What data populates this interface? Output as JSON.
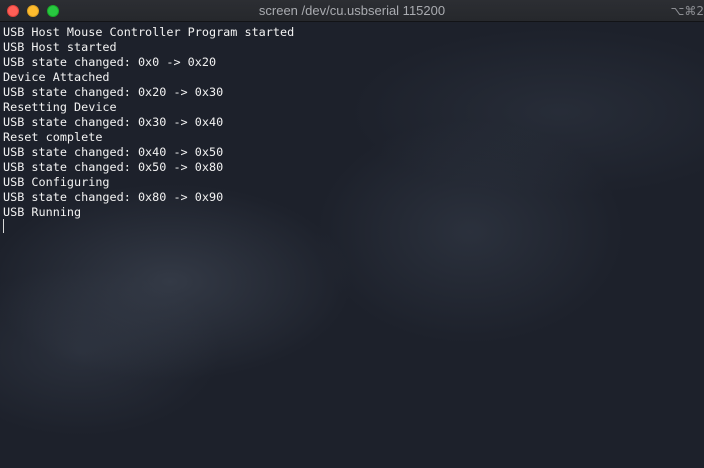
{
  "window": {
    "title": "screen /dev/cu.usbserial 115200",
    "shortcut": "⌥⌘2"
  },
  "terminal": {
    "lines": [
      "USB Host Mouse Controller Program started",
      "USB Host started",
      "USB state changed: 0x0 -> 0x20",
      "Device Attached",
      "USB state changed: 0x20 -> 0x30",
      "Resetting Device",
      "USB state changed: 0x30 -> 0x40",
      "Reset complete",
      "USB state changed: 0x40 -> 0x50",
      "USB state changed: 0x50 -> 0x80",
      "USB Configuring",
      "USB state changed: 0x80 -> 0x90",
      "USB Running"
    ]
  }
}
